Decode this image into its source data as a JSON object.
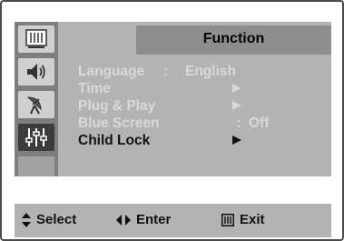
{
  "menu": {
    "title": "Function",
    "items": [
      {
        "label": "Language",
        "separator": ":",
        "value": "English",
        "state": "disabled"
      },
      {
        "label": "Time",
        "state": "disabled",
        "has_arrow": true
      },
      {
        "label": "Plug & Play",
        "state": "disabled",
        "has_arrow": true
      },
      {
        "label": "Blue Screen",
        "separator": ":",
        "value": "Off",
        "state": "disabled"
      },
      {
        "label": "Child Lock",
        "state": "selected",
        "has_arrow": true
      }
    ]
  },
  "sidebar": {
    "icons": [
      "picture-icon",
      "sound-icon",
      "channel-antenna-icon",
      "function-sliders-icon"
    ],
    "active_index": 3
  },
  "footer": {
    "select_label": "Select",
    "enter_label": "Enter",
    "exit_label": "Exit"
  },
  "colors": {
    "panel_bg": "#b3b3b3",
    "sidebar_bg": "#7e7e7e",
    "title_bg": "#8e8e8e",
    "disabled_text": "#d9d9d9",
    "active_text": "#111111"
  }
}
